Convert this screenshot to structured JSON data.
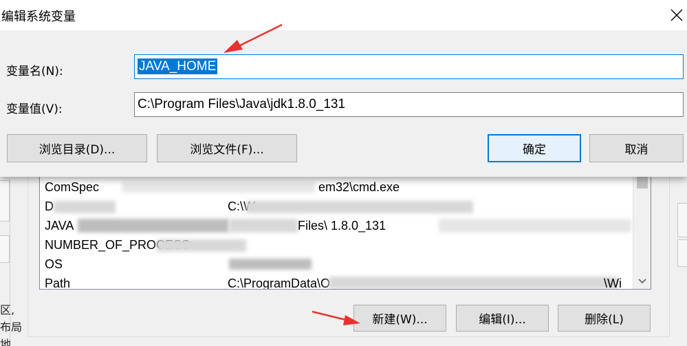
{
  "dialog": {
    "title": "编辑系统变量",
    "name_label": "变量名(N):",
    "value_label": "变量值(V):",
    "name_value": "JAVA_HOME",
    "value_value": "C:\\Program Files\\Java\\jdk1.8.0_131",
    "browse_dir_label": "浏览目录(D)...",
    "browse_file_label": "浏览文件(F)...",
    "ok_label": "确定",
    "cancel_label": "取消"
  },
  "system_vars": {
    "rows": [
      {
        "name": "ComSpec",
        "value": "em32\\cmd.exe"
      },
      {
        "name": "D",
        "value": "C:\\W"
      },
      {
        "name": "JAVA",
        "value": "Files\\ 1.8.0_131"
      },
      {
        "name": "NUMBER_OF_PROCESS",
        "value": ""
      },
      {
        "name": "OS",
        "value": ""
      },
      {
        "name": "Path",
        "value": "C:\\ProgramData\\O"
      }
    ],
    "path_value_tail": "\\Wi",
    "new_label": "新建(W)...",
    "edit_label": "编辑(I)...",
    "delete_label": "删除(L)"
  },
  "background_edge": [
    "区,",
    "布局",
    "地"
  ],
  "colors": {
    "accent": "#0078d7",
    "annotation_arrow": "#e8322e",
    "dialog_bg": "#f0f0f0"
  }
}
